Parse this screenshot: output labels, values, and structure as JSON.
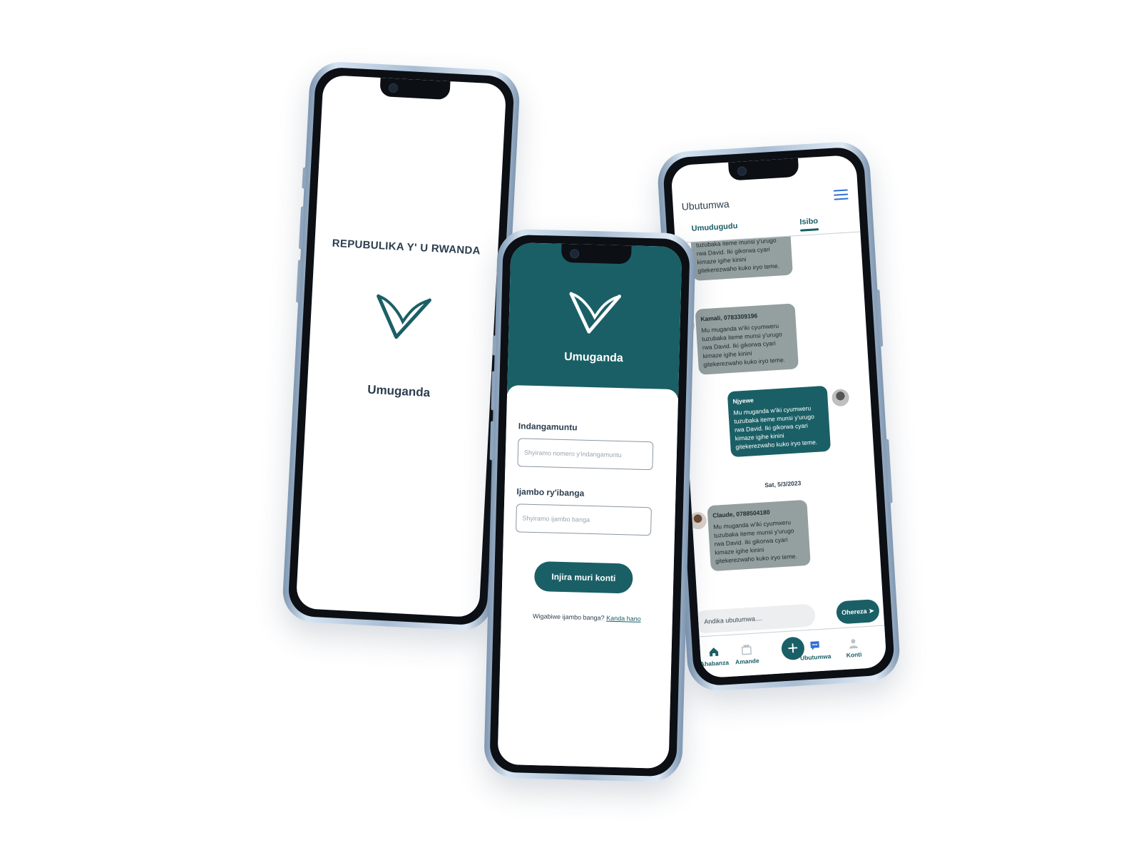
{
  "colors": {
    "primary": "#1a5f66",
    "text_dark": "#2c3e4f",
    "bubble_gray": "#949f9f",
    "link_blue": "#2f6fd6"
  },
  "splash": {
    "republic": "REPUBULIKA Y' U RWANDA",
    "app_name": "Umuganda",
    "logo_icon": "v-check-logo-icon"
  },
  "login": {
    "app_name": "Umuganda",
    "id_label": "Indangamuntu",
    "id_placeholder": "Shyiramo nomero y'indangamuntu",
    "password_label": "Ijambo ry'ibanga",
    "password_placeholder": "Shyiramo ijambo banga",
    "submit_label": "Injira muri konti",
    "forgot_text": "Wigabiwe ijambo banga?",
    "forgot_link": "Kanda hano"
  },
  "chat": {
    "title": "Ubutumwa",
    "tabs": [
      {
        "label": "Umudugudu",
        "active": false
      },
      {
        "label": "Isibo",
        "active": true
      }
    ],
    "messages": [
      {
        "direction": "in",
        "sender": "",
        "text": "Mu muganda w'iki cyumweru tuzubaka iteme munsi y'urugo rwa David. Iki gikorwa cyari kimaze igihe kinini gitekerezwaho kuko iryo teme."
      },
      {
        "direction": "in",
        "sender": "Kamali, 0783309196",
        "text": "Mu muganda w'iki cyumweru tuzubaka iteme munsi y'urugo rwa David. Iki gikorwa cyari kimaze igihe kinini gitekerezwaho kuko iryo teme."
      },
      {
        "direction": "out",
        "sender": "Njyewe",
        "text": "Mu muganda w'iki cyumweru tuzubaka iteme munsi y'urugo rwa David. Iki gikorwa cyari kimaze igihe kinini gitekerezwaho kuko iryo teme."
      },
      {
        "direction": "in",
        "sender": "Claude, 0788504180",
        "text": "Mu muganda w'iki cyumweru tuzubaka iteme munsi y'urugo rwa David. Iki gikorwa cyari kimaze igihe kinini gitekerezwaho kuko iryo teme."
      }
    ],
    "date_separator": "Sat, 5/3/2023",
    "input_placeholder": "Andika ubutumwa....",
    "send_label": "Ohereza",
    "nav": [
      {
        "label": "Ahabanza",
        "icon": "home-icon"
      },
      {
        "label": "Amande",
        "icon": "fine-box-icon"
      },
      {
        "label": "Ubutumwa",
        "icon": "chat-bubble-icon"
      },
      {
        "label": "Konti",
        "icon": "user-icon"
      }
    ]
  }
}
